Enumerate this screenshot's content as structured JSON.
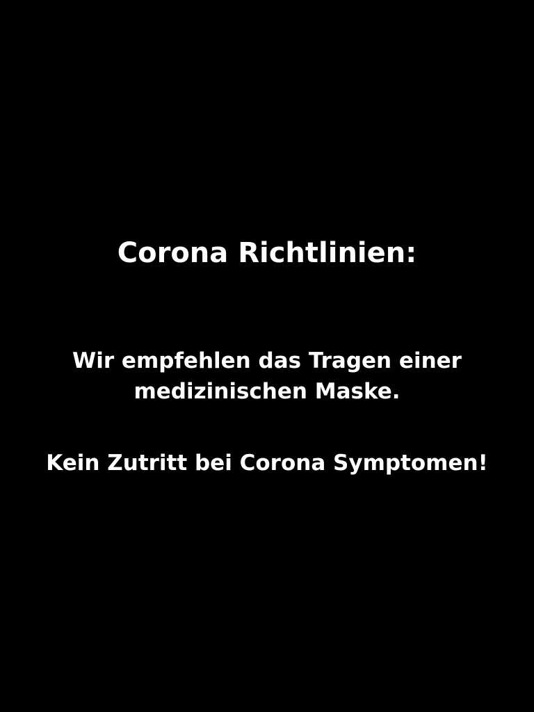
{
  "notice": {
    "title": "Corona Richtlinien:",
    "recommendation_line1": "Wir empfehlen das Tragen einer",
    "recommendation_line2": "medizinischen Maske.",
    "warning": "Kein Zutritt bei Corona Symptomen!"
  },
  "colors": {
    "background": "#000000",
    "text": "#ffffff"
  }
}
